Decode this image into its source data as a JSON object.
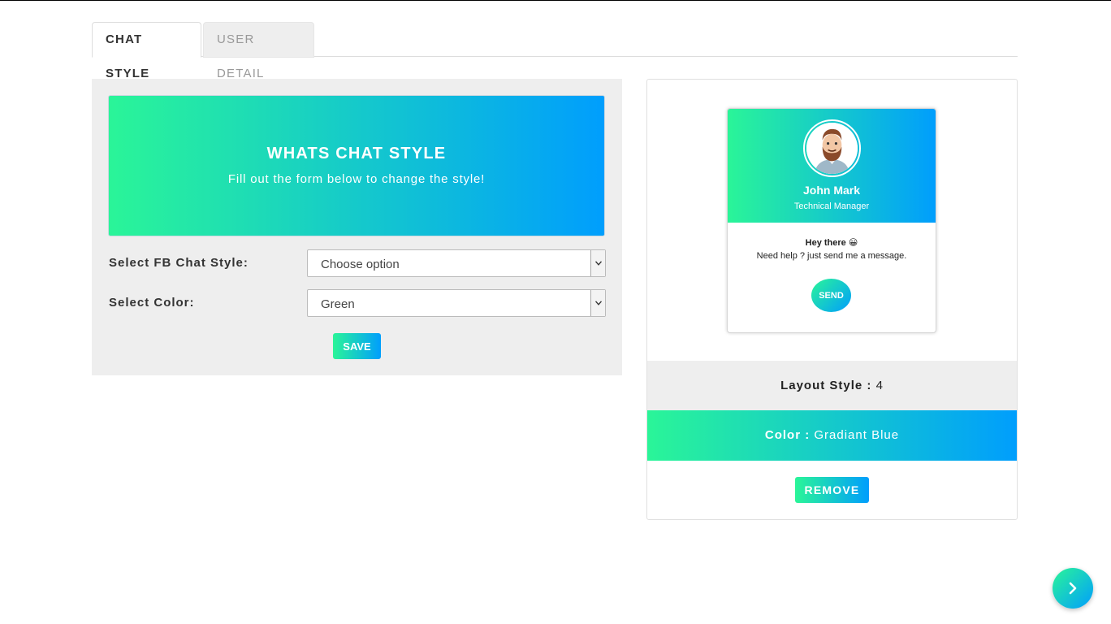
{
  "tabs": [
    {
      "label": "CHAT STYLE",
      "active": true
    },
    {
      "label": "USER DETAIL",
      "active": false
    }
  ],
  "hero": {
    "title": "WHATS CHAT STYLE",
    "subtitle": "Fill out the form below to change the style!"
  },
  "form": {
    "style_label": "Select FB Chat Style:",
    "style_value": "Choose option",
    "color_label": "Select Color:",
    "color_value": "Green",
    "save_label": "SAVE"
  },
  "preview": {
    "name": "John Mark",
    "role": "Technical Manager",
    "greeting": "Hey there 😀",
    "help_text": "Need help ? just send me a message.",
    "send_label": "SEND"
  },
  "summary": {
    "layout_label": "Layout Style :",
    "layout_value": "4",
    "color_label": "Color :",
    "color_value": "Gradiant Blue",
    "remove_label": "REMOVE"
  },
  "icons": {
    "avatar": "avatar-icon",
    "fab": "chevron-right-icon",
    "select_arrow": "chevron-down-icon"
  },
  "colors": {
    "gradient_start": "#2af598",
    "gradient_end": "#009efd",
    "panel_bg": "#eeeeee"
  }
}
